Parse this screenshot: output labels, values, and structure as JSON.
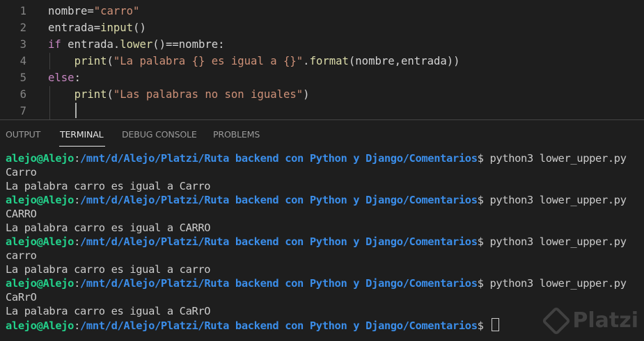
{
  "editor": {
    "top_fragment": "                         ",
    "lines": [
      {
        "num": "1",
        "tokens": [
          {
            "t": "nombre=",
            "c": "id"
          },
          {
            "t": "\"carro\"",
            "c": "str"
          }
        ]
      },
      {
        "num": "2",
        "tokens": [
          {
            "t": "entrada=",
            "c": "id"
          },
          {
            "t": "input",
            "c": "fn"
          },
          {
            "t": "()",
            "c": "id"
          }
        ]
      },
      {
        "num": "3",
        "tokens": [
          {
            "t": "if",
            "c": "kw"
          },
          {
            "t": " entrada.",
            "c": "id"
          },
          {
            "t": "lower",
            "c": "fn"
          },
          {
            "t": "()==nombre:",
            "c": "id"
          }
        ]
      },
      {
        "num": "4",
        "tokens": [
          {
            "t": "    ",
            "c": "id"
          },
          {
            "t": "print",
            "c": "fn"
          },
          {
            "t": "(",
            "c": "id"
          },
          {
            "t": "\"La palabra {} es igual a {}\"",
            "c": "str"
          },
          {
            "t": ".",
            "c": "id"
          },
          {
            "t": "format",
            "c": "fn"
          },
          {
            "t": "(nombre,entrada))",
            "c": "id"
          }
        ]
      },
      {
        "num": "5",
        "tokens": [
          {
            "t": "else",
            "c": "kw"
          },
          {
            "t": ":",
            "c": "id"
          }
        ]
      },
      {
        "num": "6",
        "tokens": [
          {
            "t": "    ",
            "c": "id"
          },
          {
            "t": "print",
            "c": "fn"
          },
          {
            "t": "(",
            "c": "id"
          },
          {
            "t": "\"Las palabras no son iguales\"",
            "c": "str"
          },
          {
            "t": ")",
            "c": "id"
          }
        ]
      },
      {
        "num": "7",
        "tokens": []
      }
    ]
  },
  "panel": {
    "tabs": [
      {
        "label": "OUTPUT",
        "active": false
      },
      {
        "label": "TERMINAL",
        "active": true
      },
      {
        "label": "DEBUG CONSOLE",
        "active": false
      },
      {
        "label": "PROBLEMS",
        "active": false
      }
    ]
  },
  "terminal": {
    "user": "alejo@Alejo",
    "path": "/mnt/d/Alejo/Platzi/Ruta backend con Python y Django/Comentarios",
    "lines": [
      {
        "type": "prompt",
        "cmd": " python3 lower_upper.py"
      },
      {
        "type": "out",
        "text": "Carro"
      },
      {
        "type": "out",
        "text": "La palabra carro es igual a Carro"
      },
      {
        "type": "prompt",
        "cmd": " python3 lower_upper.py"
      },
      {
        "type": "out",
        "text": "CARRO"
      },
      {
        "type": "out",
        "text": "La palabra carro es igual a CARRO"
      },
      {
        "type": "prompt",
        "cmd": " python3 lower_upper.py"
      },
      {
        "type": "out",
        "text": "carro"
      },
      {
        "type": "out",
        "text": "La palabra carro es igual a carro"
      },
      {
        "type": "prompt",
        "cmd": " python3 lower_upper.py"
      },
      {
        "type": "out",
        "text": "CaRrO"
      },
      {
        "type": "out",
        "text": "La palabra carro es igual a CaRrO"
      },
      {
        "type": "prompt",
        "cmd": " ",
        "cursor": true
      }
    ]
  },
  "watermark": {
    "text": "Platzi"
  },
  "colors": {
    "background": "#1e1e1e",
    "keyword": "#c586c0",
    "string": "#ce9178",
    "function": "#dcdcaa",
    "prompt_user": "#23d18b",
    "prompt_path": "#3b8eea"
  }
}
